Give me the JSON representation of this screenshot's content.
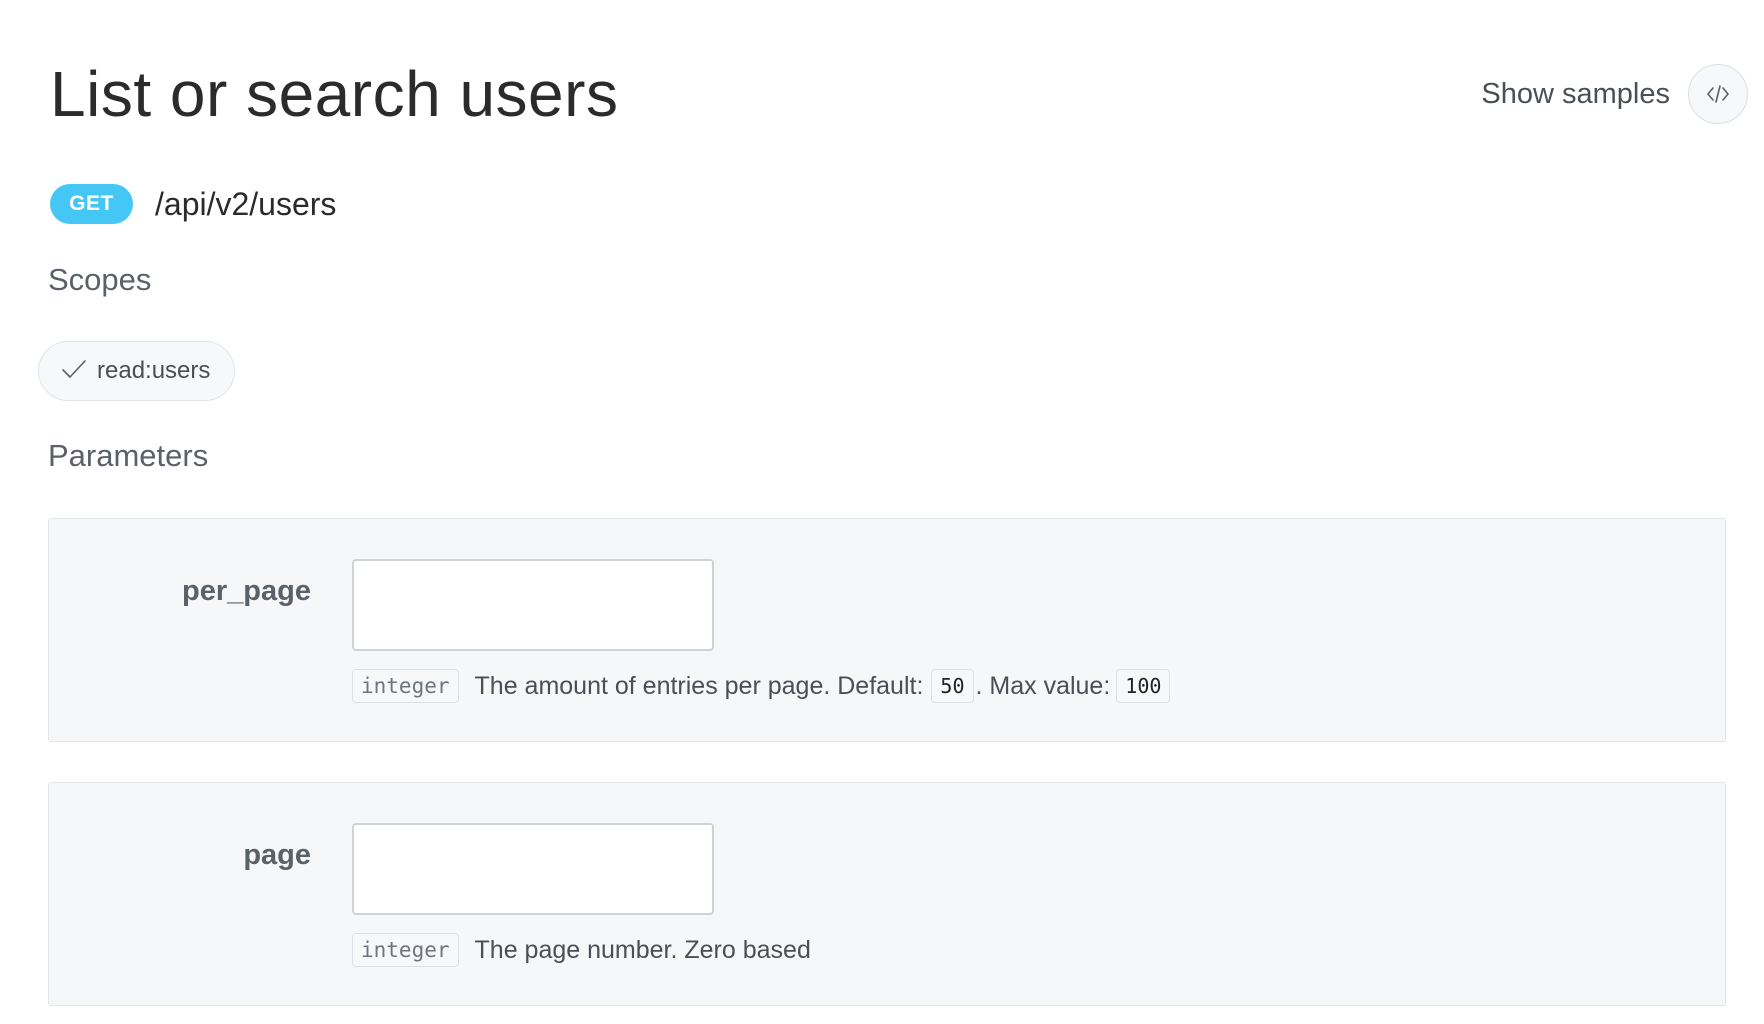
{
  "header": {
    "title": "List or search users",
    "show_samples_label": "Show samples",
    "show_samples_icon": "code-icon"
  },
  "endpoint": {
    "method": "GET",
    "path": "/api/v2/users",
    "method_color": "#44c7f4"
  },
  "scopes": {
    "heading": "Scopes",
    "items": [
      {
        "label": "read:users",
        "icon": "check-icon"
      }
    ]
  },
  "parameters": {
    "heading": "Parameters",
    "items": [
      {
        "name": "per_page",
        "value": "",
        "type": "integer",
        "description_prefix": "The amount of entries per page. Default:",
        "default_value": "50",
        "description_middle": ". Max value:",
        "max_value": "100"
      },
      {
        "name": "page",
        "value": "",
        "type": "integer",
        "description": "The page number. Zero based"
      }
    ]
  }
}
